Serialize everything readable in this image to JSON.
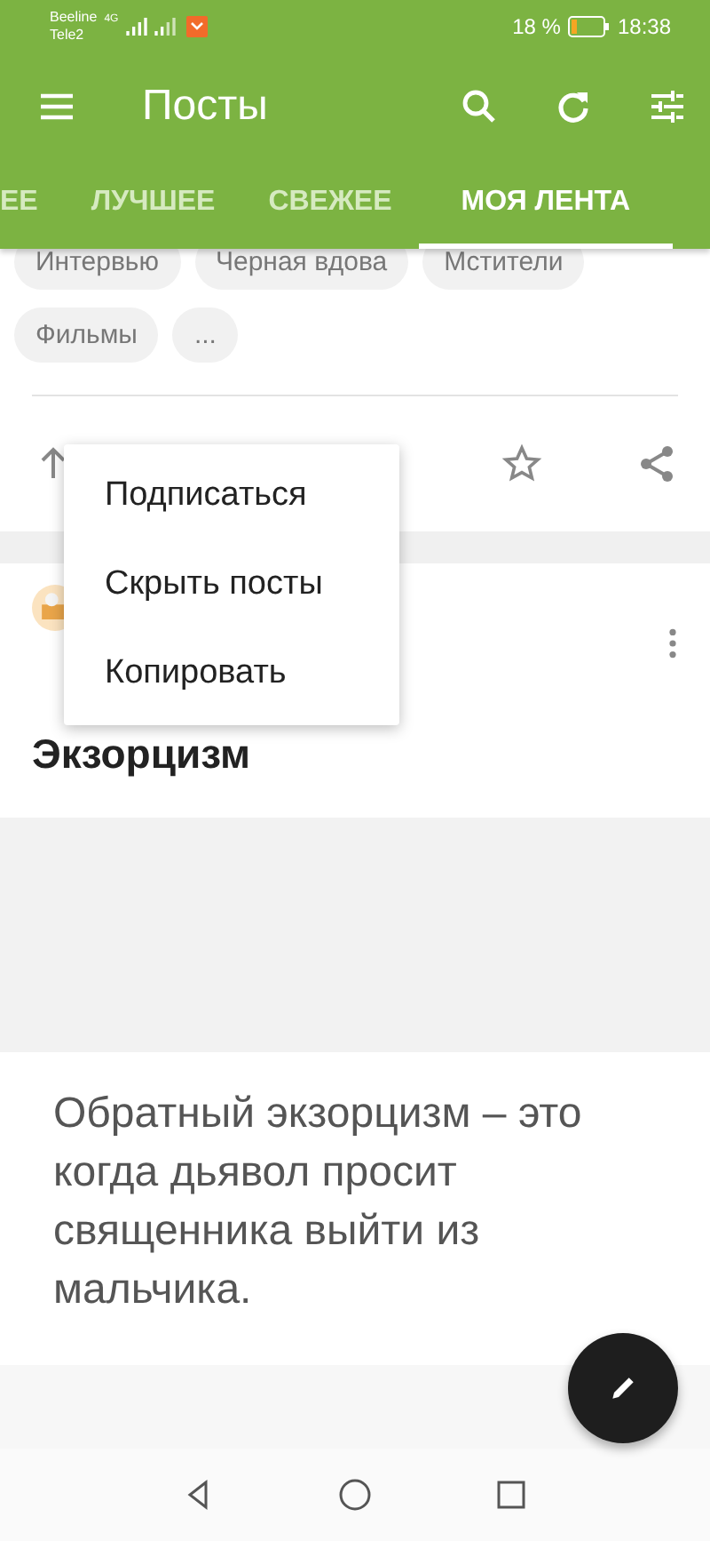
{
  "status_bar": {
    "carriers": [
      "Beeline",
      "Tele2"
    ],
    "network": "4G",
    "battery_text": "18 %",
    "time": "18:38"
  },
  "toolbar": {
    "title": "Посты"
  },
  "tabs": [
    {
      "label": "ЕЕ",
      "selected": false
    },
    {
      "label": "ЛУЧШЕЕ",
      "selected": false
    },
    {
      "label": "СВЕЖЕЕ",
      "selected": false
    },
    {
      "label": "МОЯ ЛЕНТА",
      "selected": true
    }
  ],
  "tags": [
    [
      "Интервью",
      "Черная вдова",
      "Мстители"
    ],
    [
      "Фильмы",
      "..."
    ]
  ],
  "menu": {
    "items": [
      "Подписаться",
      "Скрыть посты",
      "Копировать"
    ]
  },
  "post": {
    "title": "Экзорцизм",
    "image_text": "Обратный экзорцизм – это когда дьявол просит священника выйти из мальчика."
  }
}
